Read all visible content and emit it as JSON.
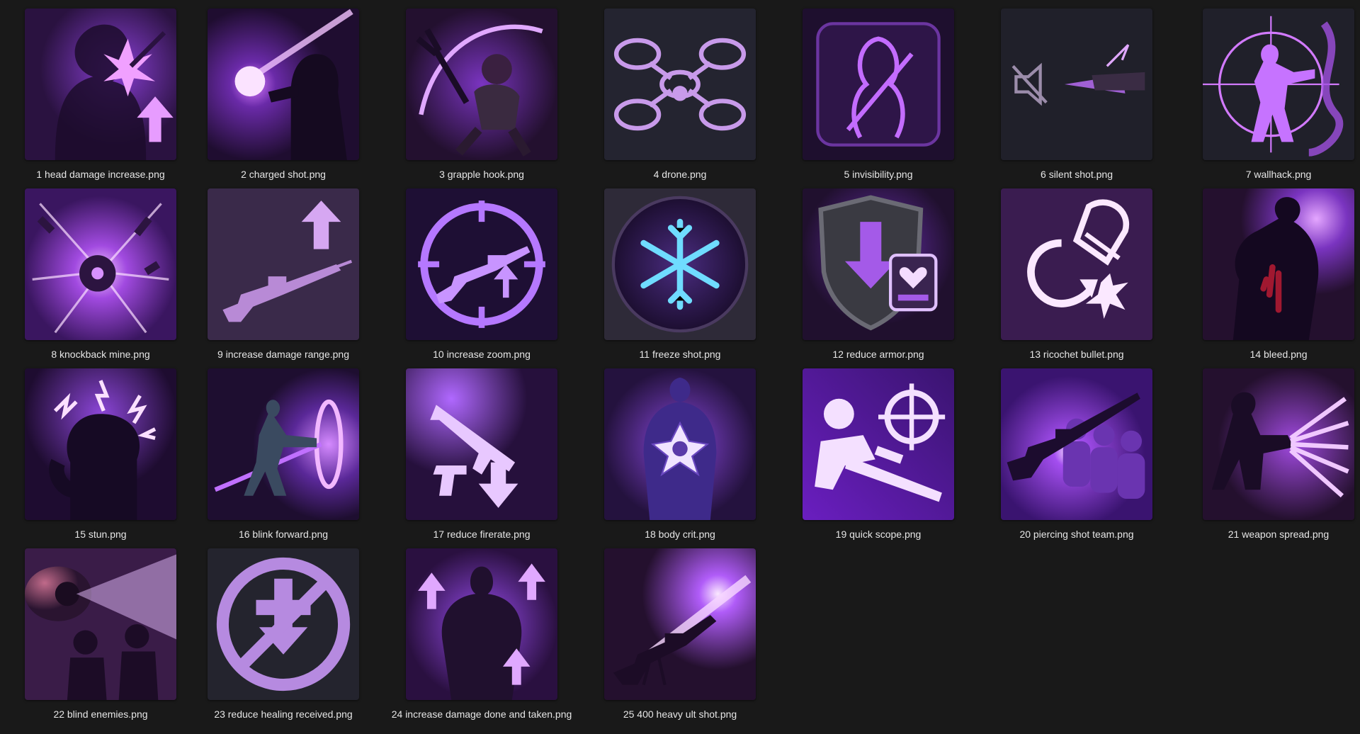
{
  "window": {
    "background": "#191919",
    "accent": "#a855f7"
  },
  "files": [
    {
      "name": "1 head damage increase.png",
      "icon": "head-damage-icon"
    },
    {
      "name": "2 charged shot.png",
      "icon": "charged-shot-icon"
    },
    {
      "name": "3 grapple hook.png",
      "icon": "grapple-hook-icon"
    },
    {
      "name": "4 drone.png",
      "icon": "drone-icon"
    },
    {
      "name": "5 invisibility.png",
      "icon": "invisibility-icon"
    },
    {
      "name": "6 silent shot.png",
      "icon": "silent-shot-icon"
    },
    {
      "name": "7 wallhack.png",
      "icon": "wallhack-icon"
    },
    {
      "name": "8 knockback mine.png",
      "icon": "knockback-mine-icon"
    },
    {
      "name": "9 increase damage range.png",
      "icon": "damage-range-icon"
    },
    {
      "name": "10 increase zoom.png",
      "icon": "zoom-icon"
    },
    {
      "name": "11 freeze shot.png",
      "icon": "freeze-shot-icon"
    },
    {
      "name": "12 reduce armor.png",
      "icon": "reduce-armor-icon"
    },
    {
      "name": "13 ricochet bullet.png",
      "icon": "ricochet-bullet-icon"
    },
    {
      "name": "14 bleed.png",
      "icon": "bleed-icon"
    },
    {
      "name": "15 stun.png",
      "icon": "stun-icon"
    },
    {
      "name": "16 blink forward.png",
      "icon": "blink-forward-icon"
    },
    {
      "name": "17 reduce firerate.png",
      "icon": "reduce-firerate-icon"
    },
    {
      "name": "18 body crit.png",
      "icon": "body-crit-icon"
    },
    {
      "name": "19 quick scope.png",
      "icon": "quick-scope-icon"
    },
    {
      "name": "20 piercing shot team.png",
      "icon": "piercing-shot-icon"
    },
    {
      "name": "21 weapon spread.png",
      "icon": "weapon-spread-icon"
    },
    {
      "name": "22 blind enemies.png",
      "icon": "blind-enemies-icon"
    },
    {
      "name": "23 reduce healing received.png",
      "icon": "reduce-healing-icon"
    },
    {
      "name": "24 increase damage done and taken.png",
      "icon": "damage-done-taken-icon"
    },
    {
      "name": "25 400 heavy ult shot.png",
      "icon": "heavy-ult-shot-icon"
    }
  ]
}
